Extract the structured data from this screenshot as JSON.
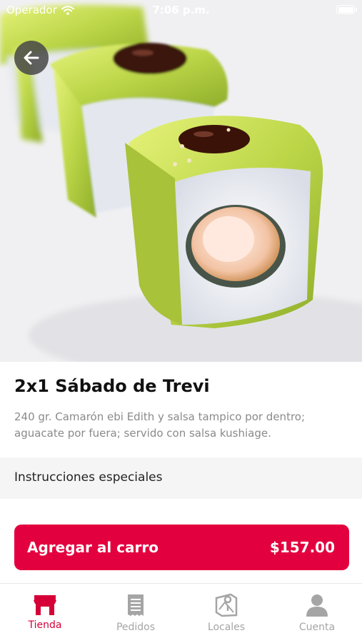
{
  "status_bar": {
    "carrier": "Operador",
    "time": "7:06 p.m."
  },
  "product": {
    "title": "2x1 Sábado de Trevi",
    "description": "240 gr. Camarón ebi Edith y salsa tampico por dentro; aguacate por fuera; servido con salsa kushiage.",
    "special_instructions_label": "Instrucciones especiales"
  },
  "cart_button": {
    "label": "Agregar al carro",
    "price": "$157.00"
  },
  "tabs": [
    {
      "label": "Tienda",
      "icon": "store-icon",
      "active": true
    },
    {
      "label": "Pedidos",
      "icon": "receipt-icon",
      "active": false
    },
    {
      "label": "Locales",
      "icon": "map-icon",
      "active": false
    },
    {
      "label": "Cuenta",
      "icon": "user-icon",
      "active": false
    }
  ],
  "colors": {
    "accent": "#e3003e",
    "tab_active": "#d50038",
    "tab_inactive": "#a5a5a5"
  }
}
